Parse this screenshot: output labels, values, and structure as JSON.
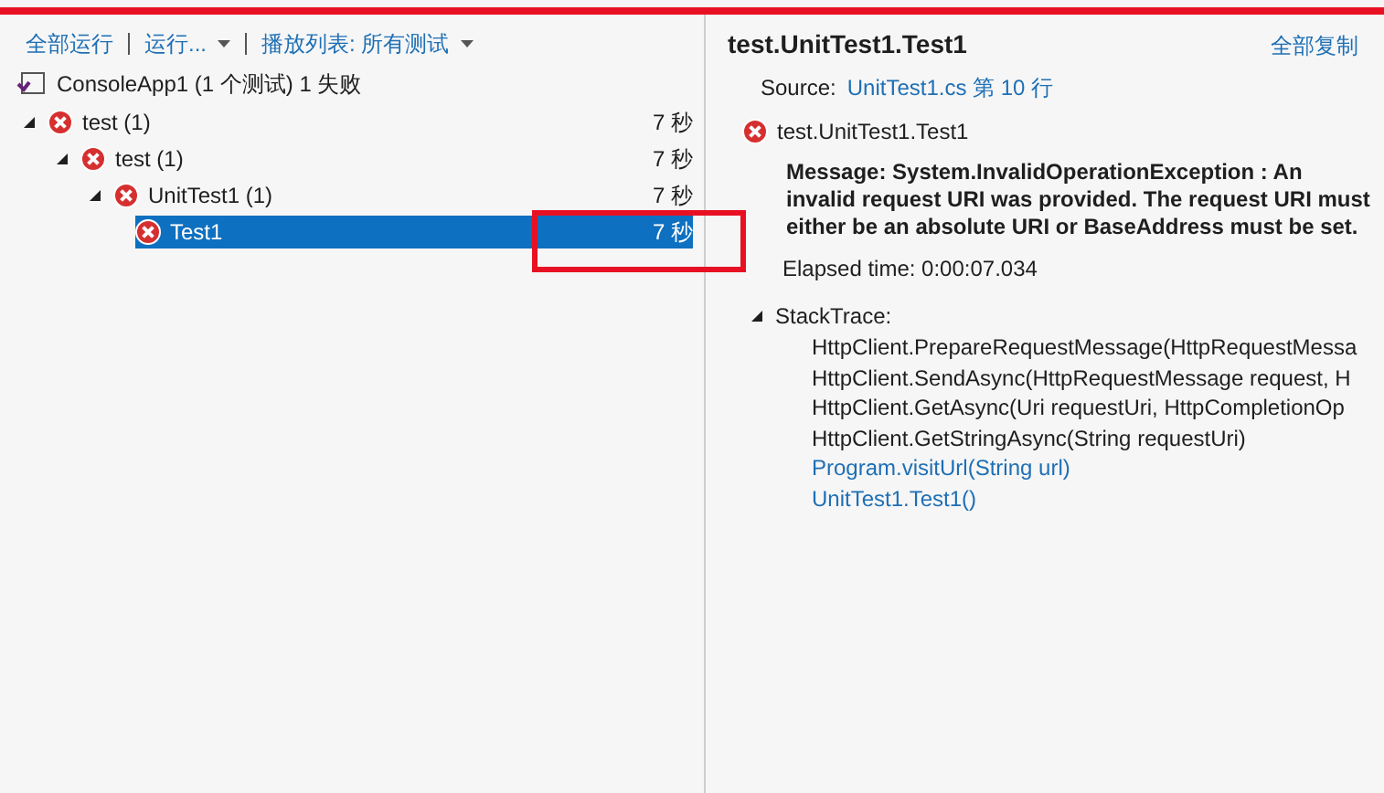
{
  "toolbar": [
    {
      "label": "全部运行",
      "dropdown": false
    },
    {
      "label": "运行...",
      "dropdown": true
    },
    {
      "label": "播放列表: 所有测试",
      "dropdown": true
    }
  ],
  "project": {
    "label": "ConsoleApp1 (1 个测试) 1 失败"
  },
  "tree": [
    {
      "label": "test (1)",
      "time": "7 秒",
      "failed": true,
      "expanded": true,
      "selected": false,
      "children": [
        {
          "label": "test (1)",
          "time": "7 秒",
          "failed": true,
          "expanded": true,
          "selected": false,
          "children": [
            {
              "label": "UnitTest1 (1)",
              "time": "7 秒",
              "failed": true,
              "expanded": true,
              "selected": false,
              "children": [
                {
                  "label": "Test1",
                  "time": "7 秒",
                  "failed": true,
                  "selected": true
                }
              ]
            }
          ]
        }
      ]
    }
  ],
  "details": {
    "title": "test.UnitTest1.Test1",
    "copy_all": "全部复制",
    "source_label": "Source:",
    "source_link": "UnitTest1.cs 第 10 行",
    "result_name": "test.UnitTest1.Test1",
    "result_failed": true,
    "message": "Message: System.InvalidOperationException : An invalid request URI was provided. The request URI must either be an absolute URI or BaseAddress must be set.",
    "elapsed": "Elapsed time: 0:00:07.034",
    "stack_label": "StackTrace:",
    "stack_expanded": true,
    "stack": [
      {
        "text": "HttpClient.PrepareRequestMessage(HttpRequestMessa",
        "kind": "frame"
      },
      {
        "text": "HttpClient.SendAsync(HttpRequestMessage request, H",
        "kind": "frame"
      },
      {
        "text": "HttpClient.GetAsync(Uri requestUri, HttpCompletionOp",
        "kind": "frame"
      },
      {
        "text": "HttpClient.GetStringAsync(String requestUri)",
        "kind": "frame"
      },
      {
        "text": "Program.visitUrl(String url)",
        "kind": "link"
      },
      {
        "text": "UnitTest1.Test1()",
        "kind": "link"
      }
    ]
  }
}
